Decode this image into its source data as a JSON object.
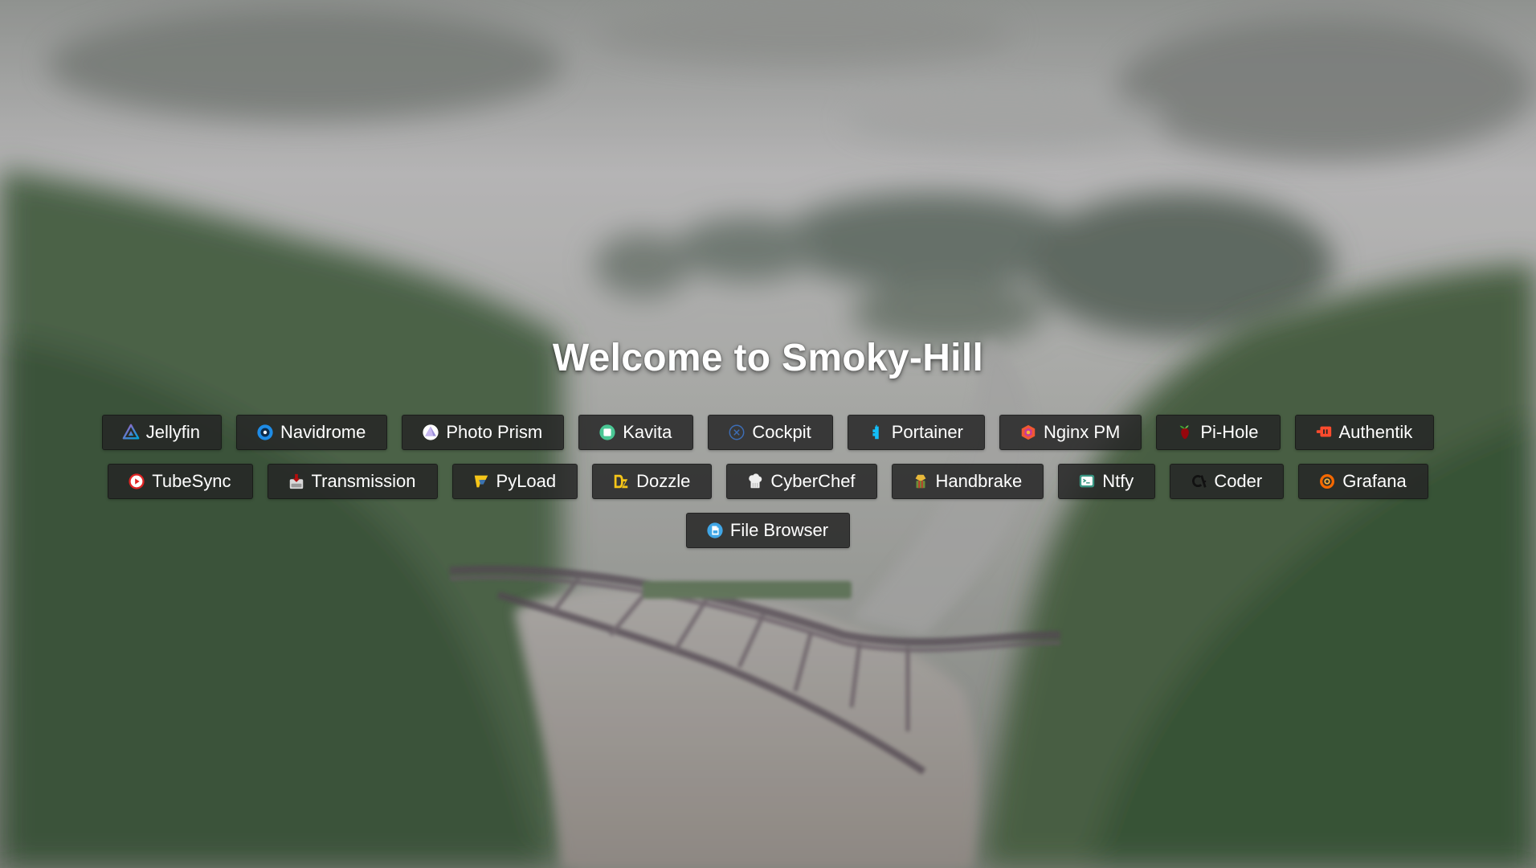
{
  "page": {
    "title": "Welcome to Smoky-Hill"
  },
  "apps": [
    {
      "label": "Jellyfin",
      "icon": "jellyfin-icon",
      "color": "#aa5cc3"
    },
    {
      "label": "Navidrome",
      "icon": "navidrome-icon",
      "color": "#1e8ce6"
    },
    {
      "label": "Photo Prism",
      "icon": "photoprism-icon",
      "color": "#9b8fd8"
    },
    {
      "label": "Kavita",
      "icon": "kavita-icon",
      "color": "#4ac694"
    },
    {
      "label": "Cockpit",
      "icon": "cockpit-icon",
      "color": "#3d6db5"
    },
    {
      "label": "Portainer",
      "icon": "portainer-icon",
      "color": "#13bef9"
    },
    {
      "label": "Nginx PM",
      "icon": "nginx-proxy-manager-icon",
      "color": "#f15833"
    },
    {
      "label": "Pi-Hole",
      "icon": "pihole-icon",
      "color": "#96060c"
    },
    {
      "label": "Authentik",
      "icon": "authentik-icon",
      "color": "#fd4b2d"
    },
    {
      "label": "TubeSync",
      "icon": "tubesync-icon",
      "color": "#e02424"
    },
    {
      "label": "Transmission",
      "icon": "transmission-icon",
      "color": "#b50d0d"
    },
    {
      "label": "PyLoad",
      "icon": "pyload-icon",
      "color": "#f5c518"
    },
    {
      "label": "Dozzle",
      "icon": "dozzle-icon",
      "color": "#f5c518"
    },
    {
      "label": "CyberChef",
      "icon": "cyberchef-icon",
      "color": "#eeeeee"
    },
    {
      "label": "Handbrake",
      "icon": "handbrake-icon",
      "color": "#c0392b"
    },
    {
      "label": "Ntfy",
      "icon": "ntfy-icon",
      "color": "#3a9784"
    },
    {
      "label": "Coder",
      "icon": "coder-icon",
      "color": "#111111"
    },
    {
      "label": "Grafana",
      "icon": "grafana-icon",
      "color": "#f46800"
    },
    {
      "label": "File Browser",
      "icon": "filebrowser-icon",
      "color": "#40a6e6"
    }
  ]
}
